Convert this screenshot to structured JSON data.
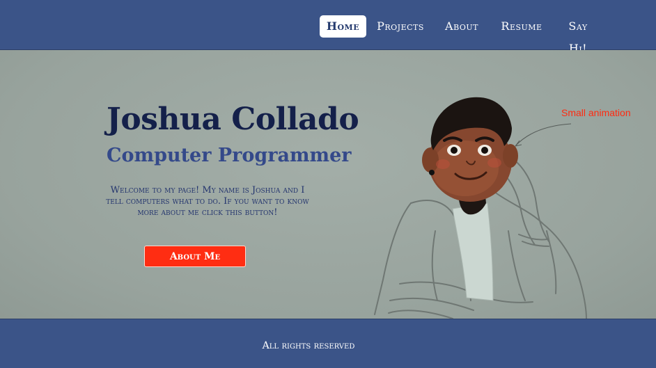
{
  "nav": {
    "items": [
      {
        "label": "Home",
        "active": true
      },
      {
        "label": "Projects",
        "active": false
      },
      {
        "label": "About",
        "active": false
      },
      {
        "label": "Resume",
        "active": false
      },
      {
        "label": "Say Hi!",
        "active": false
      }
    ]
  },
  "hero": {
    "title": "Joshua Collado",
    "subtitle": "Computer Programmer",
    "description": "Welcome to my page! My name is Joshua and I tell computers what to do.  If you want to know more about me click this button!",
    "button_label": "About Me",
    "annotation": "Small animation"
  },
  "footer": {
    "text": "All rights reserved"
  },
  "colors": {
    "nav_bg": "#3b5488",
    "hero_bg": "#9aa6a0",
    "title": "#14204a",
    "subtitle": "#34498a",
    "button": "#ff2d12",
    "annotation": "#ff2a10"
  }
}
